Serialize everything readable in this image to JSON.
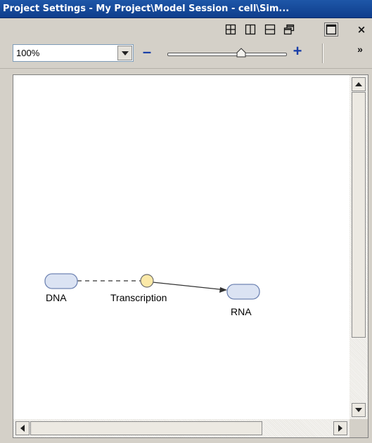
{
  "window": {
    "title": "Project Settings - My Project\\Model Session - cell\\Sim..."
  },
  "layout_buttons": [
    {
      "name": "tile-four-icon"
    },
    {
      "name": "tile-vertical-icon"
    },
    {
      "name": "tile-horizontal-icon"
    },
    {
      "name": "restore-icon"
    },
    {
      "name": "maximize-icon"
    }
  ],
  "close_label": "×",
  "toolbar": {
    "zoom_value": "100%",
    "zoom_out_label": "–",
    "zoom_in_label": "+",
    "more_label": "»",
    "zoom_level_fraction": 0.62
  },
  "diagram": {
    "nodes": [
      {
        "id": "dna",
        "label": "DNA",
        "kind": "species"
      },
      {
        "id": "transcription",
        "label": "Transcription",
        "kind": "reaction"
      },
      {
        "id": "rna",
        "label": "RNA",
        "kind": "species"
      }
    ],
    "edges": [
      {
        "from": "dna",
        "to": "transcription",
        "style": "dashed"
      },
      {
        "from": "transcription",
        "to": "rna",
        "style": "arrow"
      }
    ],
    "colors": {
      "species_fill": "#dbe3f3",
      "species_stroke": "#6f84b3",
      "reaction_fill": "#fbe9a8",
      "reaction_stroke": "#6b6b6b"
    }
  }
}
